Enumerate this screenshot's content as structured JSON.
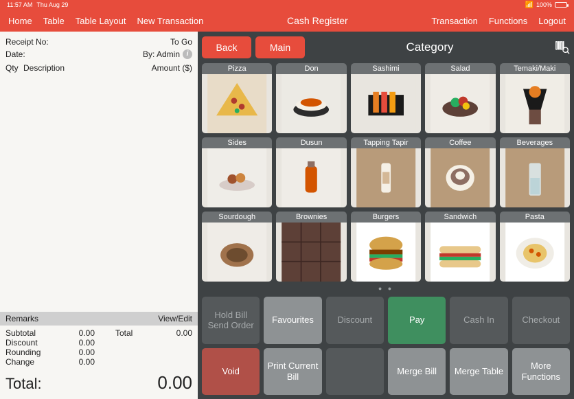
{
  "status": {
    "time": "11:57 AM",
    "date": "Thu Aug 29",
    "battery_pct": "100%"
  },
  "topnav": {
    "left": [
      "Home",
      "Table",
      "Table Layout",
      "New Transaction"
    ],
    "center": "Cash Register",
    "right": [
      "Transaction",
      "Functions",
      "Logout"
    ]
  },
  "receipt": {
    "receipt_no_label": "Receipt No:",
    "togo": "To Go",
    "date_label": "Date:",
    "by_label": "By: Admin",
    "cols": {
      "qty": "Qty",
      "desc": "Description",
      "amt": "Amount ($)"
    },
    "remarks_label": "Remarks",
    "viewedit_label": "View/Edit",
    "subtotal_label": "Subtotal",
    "subtotal": "0.00",
    "discount_label": "Discount",
    "discount": "0.00",
    "rounding_label": "Rounding",
    "rounding": "0.00",
    "change_label": "Change",
    "change": "0.00",
    "total_side_label": "Total",
    "total_side": "0.00",
    "grand_label": "Total:",
    "grand": "0.00"
  },
  "catbar": {
    "back": "Back",
    "main": "Main",
    "title": "Category"
  },
  "categories": [
    {
      "label": "Pizza"
    },
    {
      "label": "Don"
    },
    {
      "label": "Sashimi"
    },
    {
      "label": "Salad"
    },
    {
      "label": "Temaki/Maki"
    },
    {
      "label": "Sides"
    },
    {
      "label": "Dusun"
    },
    {
      "label": "Tapping Tapir"
    },
    {
      "label": "Coffee"
    },
    {
      "label": "Beverages"
    },
    {
      "label": "Sourdough"
    },
    {
      "label": "Brownies"
    },
    {
      "label": "Burgers"
    },
    {
      "label": "Sandwich"
    },
    {
      "label": "Pasta"
    }
  ],
  "actions": {
    "hold": "Hold Bill Send Order",
    "fav": "Favourites",
    "disc": "Discount",
    "pay": "Pay",
    "cashin": "Cash In",
    "checkout": "Checkout",
    "void": "Void",
    "print": "Print Current Bill",
    "blank": "",
    "mergebill": "Merge Bill",
    "mergetable": "Merge Table",
    "more": "More Functions"
  }
}
